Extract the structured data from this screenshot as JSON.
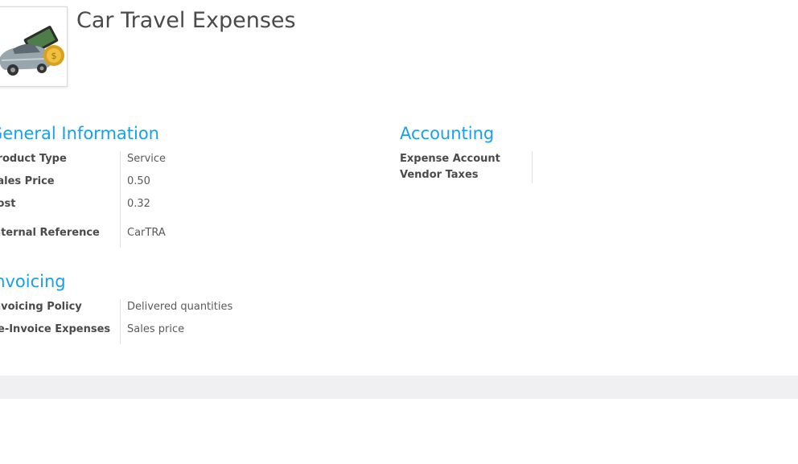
{
  "record": {
    "title": "Car Travel Expenses",
    "image_icon": "car-with-money-icon"
  },
  "general_information": {
    "heading": "General Information",
    "fields": [
      {
        "label": "Product Type",
        "value": "Service"
      },
      {
        "label": "Sales Price",
        "value": "0.50"
      },
      {
        "label": "Cost",
        "value": "0.32"
      },
      {
        "label": "Internal Reference",
        "value": "CarTRA"
      }
    ]
  },
  "accounting": {
    "heading": "Accounting",
    "fields": [
      {
        "label": "Expense Account",
        "value": ""
      },
      {
        "label": "Vendor Taxes",
        "value": ""
      }
    ]
  },
  "invoicing": {
    "heading": "Invoicing",
    "fields": [
      {
        "label": "Invoicing Policy",
        "value": "Delivered quantities"
      },
      {
        "label": "Re-Invoice Expenses",
        "value": "Sales price"
      }
    ]
  },
  "colors": {
    "section_heading": "#1aa0e8",
    "label_text": "#4a4a4a",
    "value_text": "#5a5a5a"
  }
}
